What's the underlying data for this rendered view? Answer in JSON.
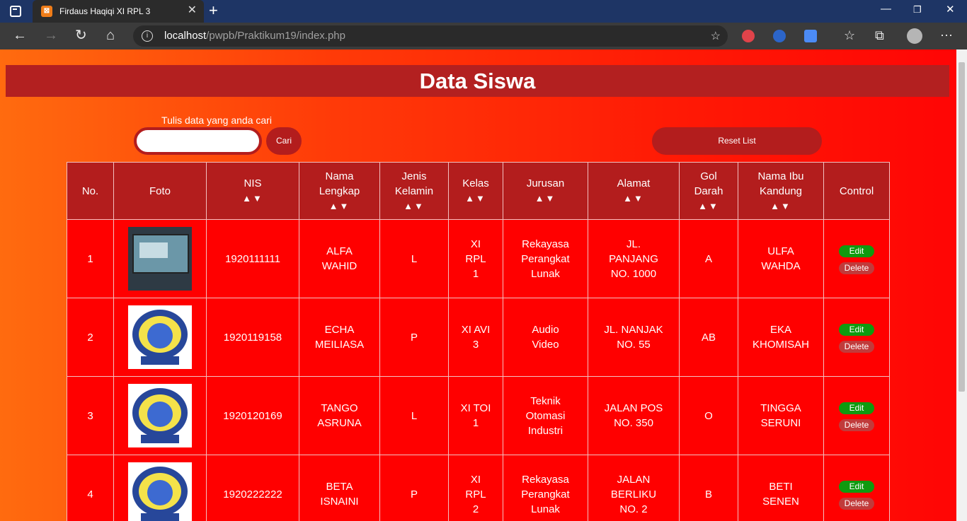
{
  "browser": {
    "tab_title": "Firdaus Haqiqi XI RPL 3",
    "url_host": "localhost",
    "url_path": "/pwpb/Praktikum19/index.php"
  },
  "page": {
    "title": "Data Siswa",
    "search_label": "Tulis data yang anda cari",
    "search_value": "",
    "search_button": "Cari",
    "reset_button": "Reset List"
  },
  "table": {
    "headers": [
      "No.",
      "Foto",
      "NIS",
      "Nama Lengkap",
      "Jenis Kelamin",
      "Kelas",
      "Jurusan",
      "Alamat",
      "Gol Darah",
      "Nama Ibu Kandung",
      "Control"
    ],
    "sort_glyph": "▲▼",
    "edit_label": "Edit",
    "delete_label": "Delete",
    "rows": [
      {
        "no": "1",
        "photo": "screen-photo",
        "nis": "1920111111",
        "nama": "ALFA WAHID",
        "jk": "L",
        "kelas": "XI RPL 1",
        "jurusan": "Rekayasa Perangkat Lunak",
        "alamat": "JL. PANJANG NO. 1000",
        "gol": "A",
        "ibu": "ULFA WAHDA"
      },
      {
        "no": "2",
        "photo": "school-logo",
        "nis": "1920119158",
        "nama": "ECHA MEILIASA",
        "jk": "P",
        "kelas": "XI AVI 3",
        "jurusan": "Audio Video",
        "alamat": "JL. NANJAK NO. 55",
        "gol": "AB",
        "ibu": "EKA KHOMISAH"
      },
      {
        "no": "3",
        "photo": "school-logo",
        "nis": "1920120169",
        "nama": "TANGO ASRUNA",
        "jk": "L",
        "kelas": "XI TOI 1",
        "jurusan": "Teknik Otomasi Industri",
        "alamat": "JALAN POS NO. 350",
        "gol": "O",
        "ibu": "TINGGA SERUNI"
      },
      {
        "no": "4",
        "photo": "school-logo",
        "nis": "1920222222",
        "nama": "BETA ISNAINI",
        "jk": "P",
        "kelas": "XI RPL 2",
        "jurusan": "Rekayasa Perangkat Lunak",
        "alamat": "JALAN BERLIKU NO. 2",
        "gol": "B",
        "ibu": "BETI SENEN"
      }
    ]
  }
}
